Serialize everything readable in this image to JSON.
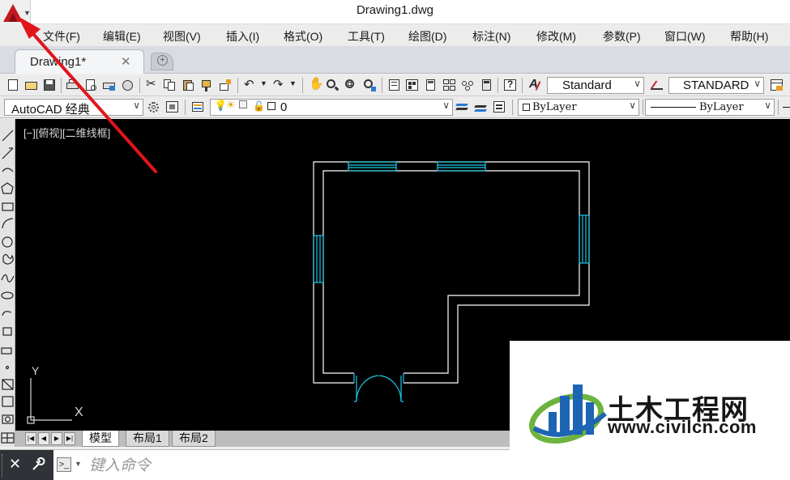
{
  "window": {
    "title": "Drawing1.dwg"
  },
  "menu": [
    "文件(F)",
    "编辑(E)",
    "视图(V)",
    "插入(I)",
    "格式(O)",
    "工具(T)",
    "绘图(D)",
    "标注(N)",
    "修改(M)",
    "参数(P)",
    "窗口(W)",
    "帮助(H)"
  ],
  "tabs": {
    "active": "Drawing1*",
    "close_glyph": "✕"
  },
  "toolbar": {
    "text_style": "Standard",
    "dim_style": "STANDARD",
    "workspace": "AutoCAD 经典",
    "layer": "0",
    "color": "ByLayer",
    "linetype": "ByLayer"
  },
  "viewport": {
    "label": "[−][俯视][二维线框]",
    "ucs_y": "Y",
    "ucs_x": "X"
  },
  "layout_tabs": [
    "模型",
    "布局1",
    "布局2"
  ],
  "command": {
    "placeholder": "键入命令"
  },
  "watermark": {
    "name": "土木工程网",
    "url": "www.civilcn.com"
  },
  "colors": {
    "canvas": "#000000",
    "walls": "#ffffff",
    "openings": "#1ec8e6",
    "arrow": "#e0151b",
    "accent": "#1d64b4"
  }
}
